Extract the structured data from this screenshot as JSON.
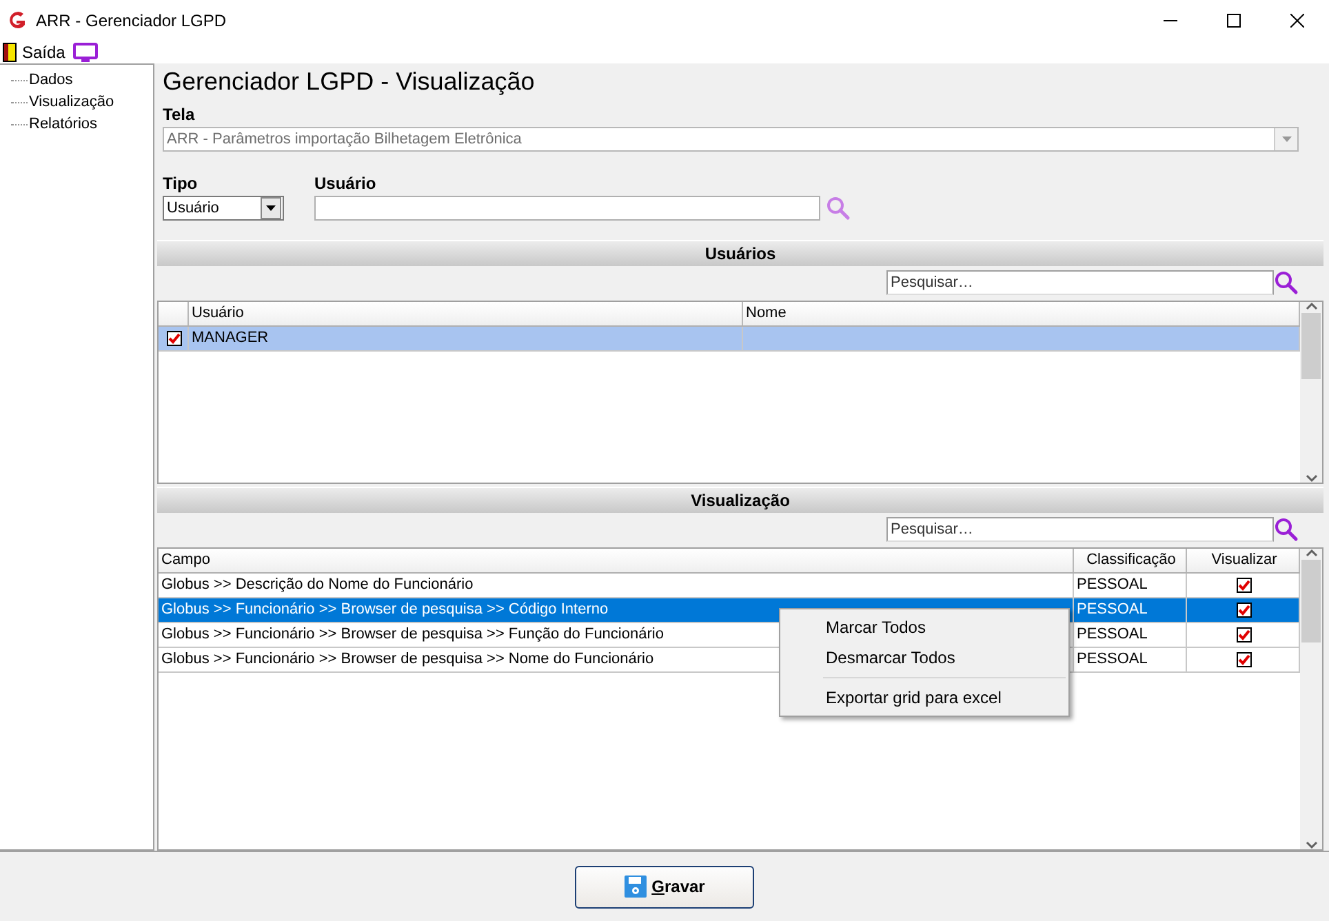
{
  "window": {
    "title": "ARR - Gerenciador LGPD"
  },
  "toolbar": {
    "exit_label": "Saída"
  },
  "tree": {
    "items": [
      {
        "label": "Dados"
      },
      {
        "label": "Visualização"
      },
      {
        "label": "Relatórios"
      }
    ]
  },
  "heading": "Gerenciador LGPD - Visualização",
  "tela": {
    "label": "Tela",
    "value": "ARR - Parâmetros importação Bilhetagem Eletrônica",
    "disabled": true
  },
  "tipo": {
    "label": "Tipo",
    "value": "Usuário"
  },
  "usuario": {
    "label": "Usuário"
  },
  "users_section": {
    "title": "Usuários",
    "search_placeholder": "Pesquisar…",
    "columns": [
      "Usuário",
      "Nome"
    ],
    "rows": [
      {
        "usuario": "MANAGER",
        "checked": true,
        "selected": true
      }
    ]
  },
  "view_section": {
    "title": "Visualização",
    "search_placeholder": "Pesquisar…",
    "columns": [
      "Campo",
      "Classificação",
      "Visualizar"
    ],
    "rows": [
      {
        "campo": "Globus >> Descrição do Nome do Funcionário",
        "classificacao": "PESSOAL",
        "visualizar": true,
        "selected": false
      },
      {
        "campo": "Globus >> Funcionário >> Browser de pesquisa >> Código Interno",
        "classificacao": "PESSOAL",
        "visualizar": true,
        "selected": true
      },
      {
        "campo": "Globus >> Funcionário >> Browser de pesquisa >> Função do Funcionário",
        "classificacao": "PESSOAL",
        "visualizar": true,
        "selected": false
      },
      {
        "campo": "Globus >> Funcionário >> Browser de pesquisa >> Nome do Funcionário",
        "classificacao": "PESSOAL",
        "visualizar": true,
        "selected": false
      }
    ]
  },
  "context_menu": {
    "items": [
      {
        "kind": "item",
        "label": "Marcar Todos"
      },
      {
        "kind": "item",
        "label": "Desmarcar Todos"
      },
      {
        "kind": "separator"
      },
      {
        "kind": "item",
        "label": "Exportar grid para excel"
      }
    ]
  },
  "save_button": {
    "label": "Gravar"
  }
}
